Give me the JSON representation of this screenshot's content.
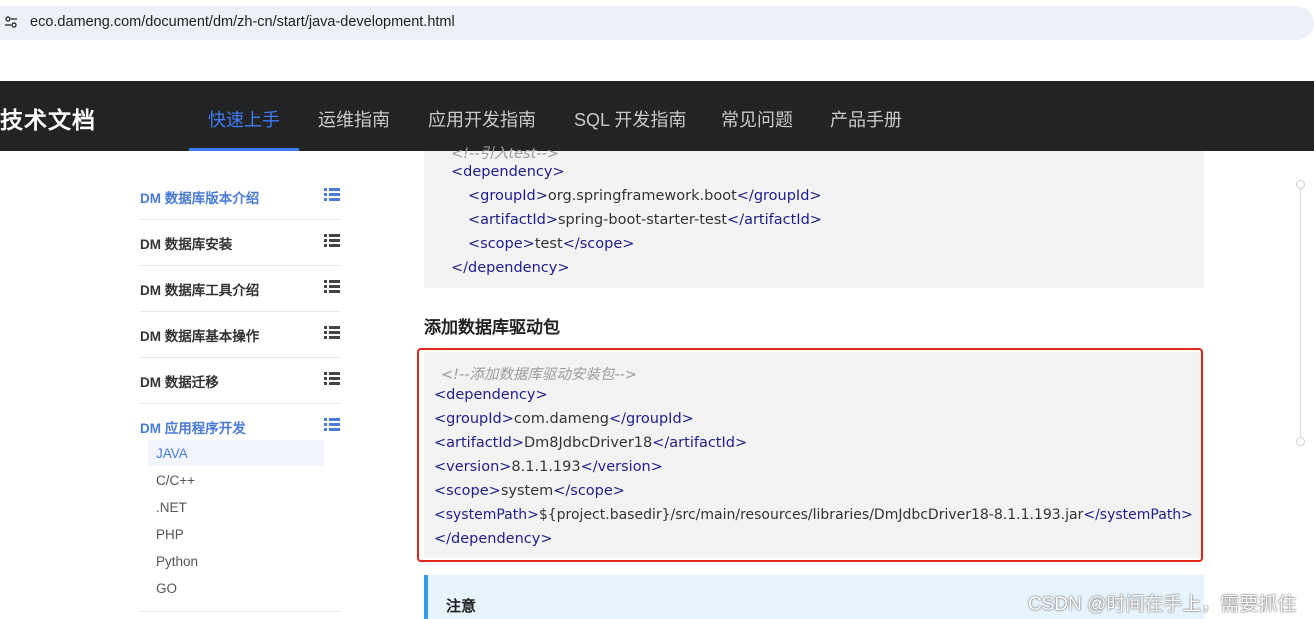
{
  "browser": {
    "url": "eco.dameng.com/document/dm/zh-cn/start/java-development.html",
    "site_info_icon": "tune-icon"
  },
  "header": {
    "brand": "技术文档",
    "nav": [
      {
        "label": "快速上手",
        "active": true
      },
      {
        "label": "运维指南",
        "active": false
      },
      {
        "label": "应用开发指南",
        "active": false
      },
      {
        "label": "SQL 开发指南",
        "active": false
      },
      {
        "label": "常见问题",
        "active": false
      },
      {
        "label": "产品手册",
        "active": false
      }
    ]
  },
  "sidebar": {
    "items": [
      {
        "label": "DM 数据库版本介绍",
        "icon": "list-icon",
        "active": true
      },
      {
        "label": "DM 数据库安装",
        "icon": "list-icon",
        "active": false
      },
      {
        "label": "DM 数据库工具介绍",
        "icon": "list-icon",
        "active": false
      },
      {
        "label": "DM 数据库基本操作",
        "icon": "list-icon",
        "active": false
      },
      {
        "label": "DM 数据迁移",
        "icon": "list-icon",
        "active": false
      },
      {
        "label": "DM 应用程序开发",
        "icon": "list-icon",
        "active": true
      }
    ],
    "subitems": [
      {
        "label": "JAVA",
        "active": true
      },
      {
        "label": "C/C++",
        "active": false
      },
      {
        "label": ".NET",
        "active": false
      },
      {
        "label": "PHP",
        "active": false
      },
      {
        "label": "Python",
        "active": false
      },
      {
        "label": "GO",
        "active": false
      }
    ]
  },
  "content": {
    "top_code": {
      "partial_comment": "<!--引入test-->",
      "dep_open": "<dependency>",
      "group_open": "<groupId>",
      "group_value": "org.springframework.boot",
      "group_close": "</groupId>",
      "artifact_open": "<artifactId>",
      "artifact_value": "spring-boot-starter-test",
      "artifact_close": "</artifactId>",
      "scope_open": "<scope>",
      "scope_value": "test",
      "scope_close": "</scope>",
      "dep_close": "</dependency>"
    },
    "section_title": "添加数据库驱动包",
    "driver_code": {
      "comment": "<!--添加数据库驱动安装包-->",
      "dep_open": "<dependency>",
      "group_open": "<groupId>",
      "group_value": "com.dameng",
      "group_close": "</groupId>",
      "artifact_open": "<artifactId>",
      "artifact_value": "Dm8JdbcDriver18",
      "artifact_close": "</artifactId>",
      "version_open": "<version>",
      "version_value": "8.1.1.193",
      "version_close": "</version>",
      "scope_open": "<scope>",
      "scope_value": "system",
      "scope_close": "</scope>",
      "path_open": "<systemPath>",
      "path_value": "${project.basedir}/src/main/resources/libraries/DmJdbcDriver18-8.1.1.193.jar",
      "path_close": "</systemPath>",
      "dep_close": "</dependency>"
    },
    "note_title": "注意"
  },
  "watermark": "CSDN @时间在手上，需要抓住",
  "colors": {
    "nav_bg": "#232323",
    "accent": "#3d7cf5",
    "highlight_border": "#e0251f",
    "xml_tag": "#1d1d8f"
  }
}
